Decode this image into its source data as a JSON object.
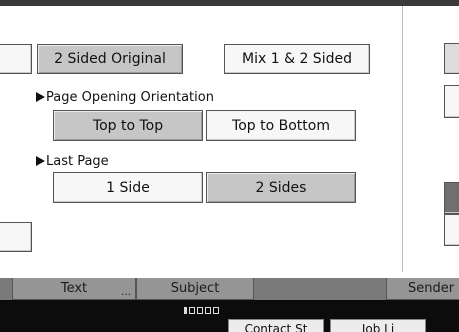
{
  "original_type": {
    "two_sided_original_label": "2 Sided Original",
    "mix_label": "Mix 1 & 2 Sided"
  },
  "page_opening_orientation": {
    "heading": "Page Opening Orientation",
    "top_to_top_label": "Top to Top",
    "top_to_bottom_label": "Top to Bottom"
  },
  "last_page": {
    "heading": "Last Page",
    "one_side_label": "1 Side",
    "two_sides_label": "2 Sides"
  },
  "tabs": {
    "text_label": "Text",
    "subject_label": "Subject",
    "sender_label": "Sender"
  },
  "status_bar": {
    "left_button_label": "Contact St",
    "right_button_label": "Job Li"
  },
  "colors": {
    "selected_button": "#c6c6c6",
    "unselected_button": "#f7f7f7",
    "tab_bar": "#7a7a7a",
    "status_bar": "#0c0c0c"
  }
}
